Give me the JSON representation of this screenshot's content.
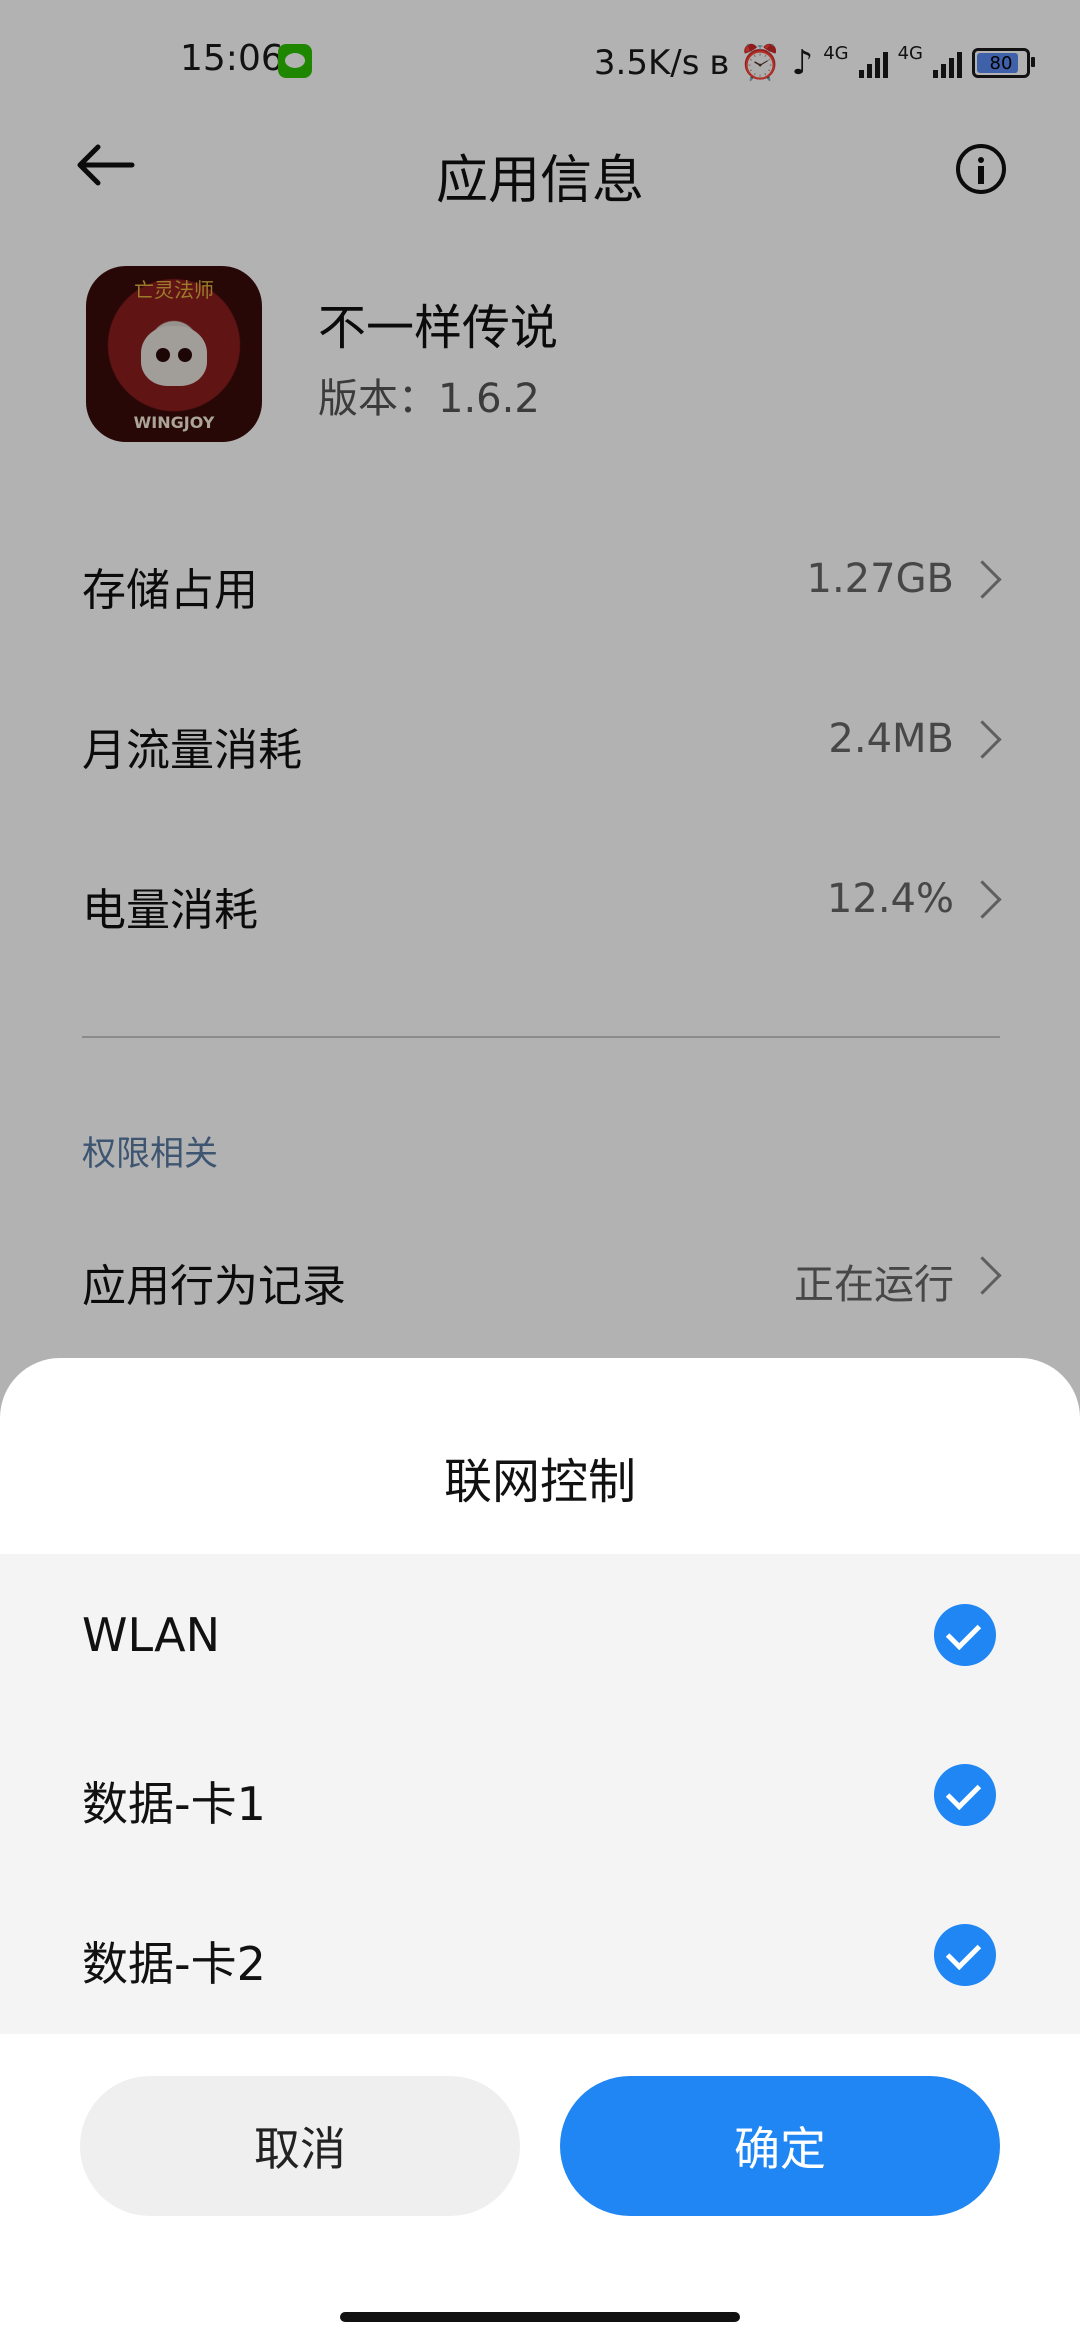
{
  "status_bar": {
    "time": "15:06",
    "net_speed": "3.5K/s",
    "sim1_label": "4G",
    "sim2_label": "4G",
    "battery": "80"
  },
  "header": {
    "title": "应用信息"
  },
  "app": {
    "name": "不一样传说",
    "version": "版本：1.6.2",
    "icon_caption": "亡灵法师",
    "icon_brand": "WINGJOY"
  },
  "rows": [
    {
      "label": "存储占用",
      "value": "1.27GB"
    },
    {
      "label": "月流量消耗",
      "value": "2.4MB"
    },
    {
      "label": "电量消耗",
      "value": "12.4%"
    }
  ],
  "permissions": {
    "section_title": "权限相关",
    "behavior_label": "应用行为记录",
    "behavior_value": "正在运行"
  },
  "dialog": {
    "title": "联网控制",
    "options": [
      {
        "label": "WLAN",
        "checked": true
      },
      {
        "label": "数据-卡1",
        "checked": true
      },
      {
        "label": "数据-卡2",
        "checked": true
      }
    ],
    "cancel_label": "取消",
    "confirm_label": "确定"
  },
  "colors": {
    "accent": "#1f86f3",
    "overlay": "rgba(0,0,0,0.30)"
  }
}
